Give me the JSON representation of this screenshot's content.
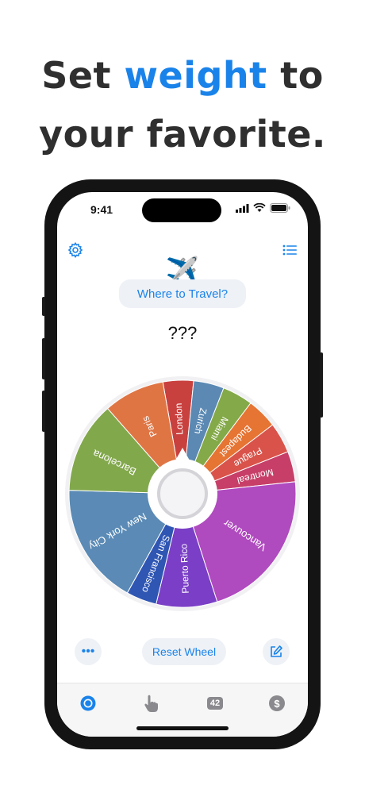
{
  "headline": {
    "prefix": "Set ",
    "accent": "weight",
    "suffix": " to",
    "line2": "your favorite."
  },
  "status_bar": {
    "time": "9:41"
  },
  "header": {
    "settings_icon": "gear-icon",
    "list_icon": "list-icon"
  },
  "title": {
    "emoji": "✈️",
    "label": "Where to Travel?"
  },
  "result": "???",
  "wheel": {
    "segments": [
      {
        "label": "London",
        "color": "#c8413f",
        "weight": 1
      },
      {
        "label": "Zurich",
        "color": "#5b89b3",
        "weight": 1
      },
      {
        "label": "Miami",
        "color": "#84a948",
        "weight": 1
      },
      {
        "label": "Budapest",
        "color": "#e67433",
        "weight": 1
      },
      {
        "label": "Prague",
        "color": "#d9534a",
        "weight": 1
      },
      {
        "label": "Montreal",
        "color": "#c73f68",
        "weight": 1
      },
      {
        "label": "Vancouver",
        "color": "#b04abf",
        "weight": 5
      },
      {
        "label": "Puerto Rico",
        "color": "#7a3fc6",
        "weight": 2
      },
      {
        "label": "San Francisco",
        "color": "#2f56b3",
        "weight": 1
      },
      {
        "label": "New York City",
        "color": "#5a8ab5",
        "weight": 4
      },
      {
        "label": "Barcelona",
        "color": "#82a84c",
        "weight": 3
      },
      {
        "label": "Paris",
        "color": "#e07544",
        "weight": 2
      }
    ]
  },
  "controls": {
    "more_label": "•••",
    "reset_label": "Reset Wheel",
    "edit_icon": "edit-icon"
  },
  "tabs": [
    {
      "icon": "spin-wheel-icon",
      "active": true
    },
    {
      "icon": "tap-hand-icon",
      "active": false
    },
    {
      "icon": "number-badge-icon",
      "label": "42",
      "active": false
    },
    {
      "icon": "dollar-icon",
      "label": "$",
      "active": false
    }
  ]
}
